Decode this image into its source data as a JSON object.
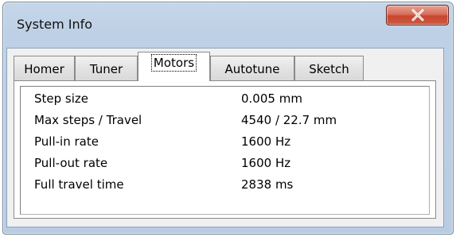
{
  "window": {
    "title": "System Info"
  },
  "tabs": [
    {
      "label": "Homer",
      "selected": false
    },
    {
      "label": "Tuner",
      "selected": false
    },
    {
      "label": "Motors",
      "selected": true
    },
    {
      "label": "Autotune",
      "selected": false
    },
    {
      "label": "Sketch",
      "selected": false
    }
  ],
  "rows": [
    {
      "key": "Step size",
      "value": "0.005 mm"
    },
    {
      "key": "Max steps / Travel",
      "value": "4540 / 22.7 mm"
    },
    {
      "key": "Pull-in rate",
      "value": "1600 Hz"
    },
    {
      "key": "Pull-out rate",
      "value": "1600 Hz"
    },
    {
      "key": "Full travel time",
      "value": "2838 ms"
    }
  ],
  "colors": {
    "close_button": "#c9452f",
    "frame": "#bed0e5"
  }
}
